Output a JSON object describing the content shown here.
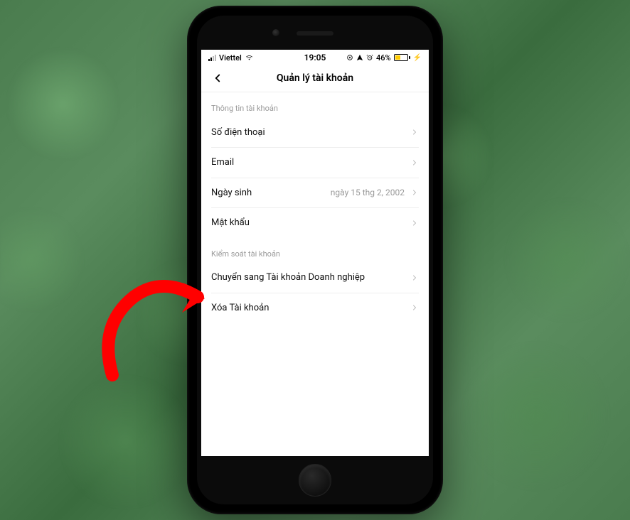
{
  "status_bar": {
    "carrier": "Viettel",
    "time": "19:05",
    "battery_percent": "46%"
  },
  "header": {
    "title": "Quản lý tài khoản"
  },
  "sections": {
    "account_info": {
      "title": "Thông tin tài khoản",
      "rows": {
        "phone": {
          "label": "Số điện thoại"
        },
        "email": {
          "label": "Email"
        },
        "birthday": {
          "label": "Ngày sinh",
          "value": "ngày 15 thg 2, 2002"
        },
        "password": {
          "label": "Mật khẩu"
        }
      }
    },
    "account_control": {
      "title": "Kiểm soát tài khoản",
      "rows": {
        "switch_business": {
          "label": "Chuyển sang Tài khoản Doanh nghiệp"
        },
        "delete_account": {
          "label": "Xóa Tài khoản"
        }
      }
    }
  }
}
